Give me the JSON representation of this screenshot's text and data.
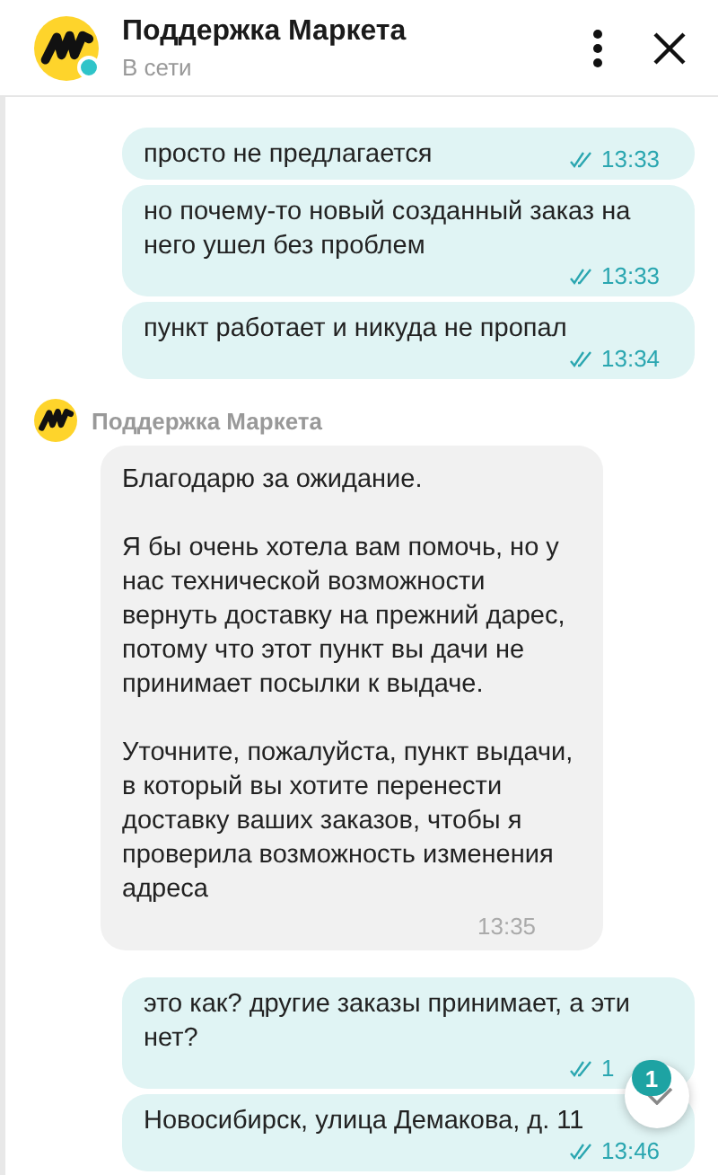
{
  "header": {
    "title": "Поддержка Маркета",
    "status": "В сети",
    "online": true
  },
  "messages": [
    {
      "kind": "outgoing",
      "text": "просто не предлагается",
      "time": "13:33",
      "read": true
    },
    {
      "kind": "outgoing",
      "text": "но почему-то новый созданный заказ на него ушел без проблем",
      "time": "13:33",
      "read": true
    },
    {
      "kind": "outgoing",
      "text": "пункт работает и никуда не пропал",
      "time": "13:34",
      "read": true
    },
    {
      "kind": "incoming",
      "sender": "Поддержка Маркета",
      "text": "Благодарю за ожидание.\n\nЯ бы очень хотела вам помочь, но у нас технической возможности вернуть доставку на прежний дарес, потому что этот пункт вы дачи не принимает посылки к выдаче.\n\nУточните, пожалуйста, пункт выдачи, в который вы хотите перенести доставку ваших заказов, чтобы я проверила возможность изменения адреса",
      "time": "13:35"
    },
    {
      "kind": "outgoing",
      "text": "это как? другие заказы принимает, а эти нет?",
      "time": "1",
      "read": true
    },
    {
      "kind": "outgoing",
      "text": "Новосибирск, улица Демакова, д. 11",
      "time": "13:46",
      "read": true
    }
  ],
  "scroll_button": {
    "unread_count": "1"
  }
}
